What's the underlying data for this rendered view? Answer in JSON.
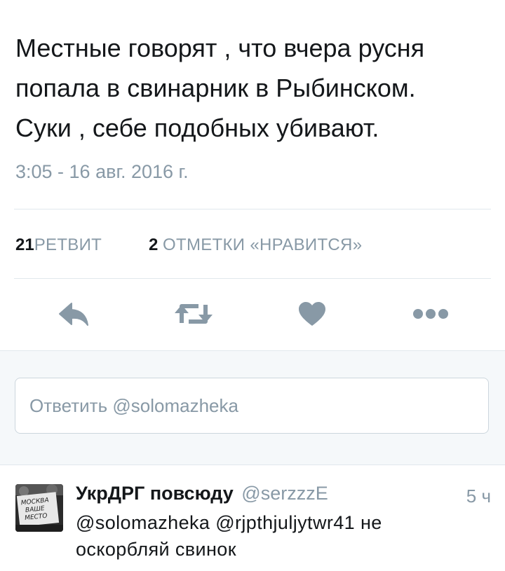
{
  "tweet": {
    "text_lines": [
      "Местные говорят , что вчера русня",
      "попала в свинарник в Рыбинском.",
      "Суки , себе подобных убивают."
    ],
    "timestamp": "3:05 - 16 авг. 2016 г."
  },
  "stats": {
    "retweets_count": "21",
    "retweets_label": "РЕТВИТ",
    "likes_count": "2",
    "likes_label": "ОТМЕТКИ «НРАВИТСЯ»"
  },
  "actions": {
    "reply_icon": "reply-icon",
    "retweet_icon": "retweet-icon",
    "like_icon": "heart-icon",
    "more_icon": "more-icon",
    "icon_color": "#8899a6"
  },
  "reply_box": {
    "placeholder": "Ответить @solomazheka"
  },
  "reply": {
    "author_name": "УкрДРГ повсюду",
    "author_handle": "@serzzzE",
    "time": "5 ч",
    "text_lines": [
      "@solomazheka @rjpthjuljytwr41 не",
      "оскорбляй свинок"
    ],
    "avatar_sign_text": "МОСКВА ВАШЕ МЕСТО"
  }
}
